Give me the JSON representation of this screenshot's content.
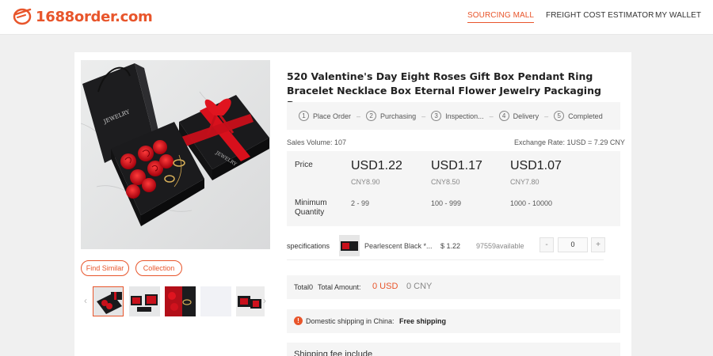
{
  "header": {
    "logo_text": "1688order.com",
    "nav": [
      "SOURCING MALL",
      "FREIGHT COST ESTIMATOR",
      "MY WALLET"
    ]
  },
  "product": {
    "title": "520 Valentine's Day Eight Roses Gift Box Pendant Ring Bracelet Necklace Box Eternal Flower Jewelry Packaging Box",
    "gift_box_text": "JEWELRY"
  },
  "steps": [
    {
      "num": "1",
      "label": "Place Order"
    },
    {
      "num": "2",
      "label": "Purchasing"
    },
    {
      "num": "3",
      "label": "Inspection..."
    },
    {
      "num": "4",
      "label": "Delivery"
    },
    {
      "num": "5",
      "label": "Completed"
    }
  ],
  "sales_volume": "Sales Volume: 107",
  "exchange_rate": "Exchange Rate: 1USD = 7.29 CNY",
  "price": {
    "price_label": "Price",
    "min_qty_label": "Minimum Quantity",
    "tiers": [
      {
        "usd": "USD1.22",
        "cny": "CNY8.90",
        "qty": "2 - 99"
      },
      {
        "usd": "USD1.17",
        "cny": "CNY8.50",
        "qty": "100 - 999"
      },
      {
        "usd": "USD1.07",
        "cny": "CNY7.80",
        "qty": "1000 - 10000"
      }
    ]
  },
  "buttons": {
    "find_similar": "Find Similar",
    "collection": "Collection"
  },
  "spec": {
    "label": "specifications",
    "name": "Pearlescent Black *...",
    "price": "$ 1.22",
    "available": "97559available",
    "minus": "-",
    "qty": "0",
    "plus": "+"
  },
  "total": {
    "total_label": "Total0",
    "amount_label": "Total Amount:",
    "usd": "0 USD",
    "cny": "0 CNY"
  },
  "shipping": {
    "text": "Domestic shipping in China:",
    "value": "Free shipping"
  },
  "fee": {
    "text": "Shipping fee include"
  },
  "colors": {
    "accent": "#e8552b",
    "panel": "#f5f5f5",
    "page": "#f0f0f0"
  }
}
